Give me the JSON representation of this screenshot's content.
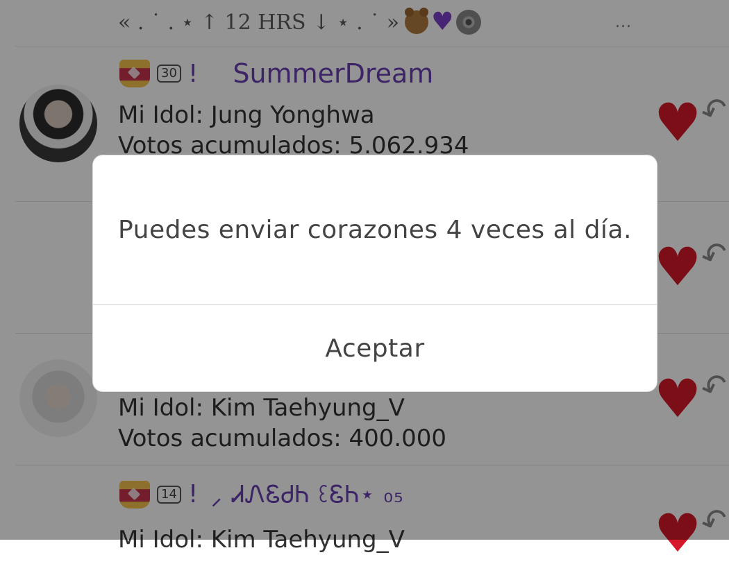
{
  "header_line": {
    "text": "« . ˙ . ⋆ ↑ 12 HRS ↓ ⋆ . ˙ »",
    "emoji": [
      "teddy-bear",
      "purple-heart",
      "disc"
    ],
    "more_label": "..."
  },
  "items": [
    {
      "level": "30",
      "bang": "!",
      "username": "SummerDream",
      "idol_line": "Mi Idol: Jung Yonghwa",
      "votes_line": "Votos acumulados: 5.062.934"
    },
    {
      "idol_line": "Mi Idol: Kim Taehyung_V",
      "votes_line": "Votos acumulados: 400.000"
    },
    {
      "level": "14",
      "bang": "!",
      "username": "⸝ ᏗᏁᏋᏧᏂ ꘓᏋᏂ⋆ ₀₅",
      "idol_line": "Mi Idol: Kim Taehyung_V"
    }
  ],
  "dialog": {
    "message": "Puedes enviar corazones 4 veces al día.",
    "button_label": "Aceptar"
  },
  "colors": {
    "accent_purple": "#6a3fb1",
    "heart_red": "#d6192a",
    "overlay": "rgba(0,0,0,0.42)"
  }
}
